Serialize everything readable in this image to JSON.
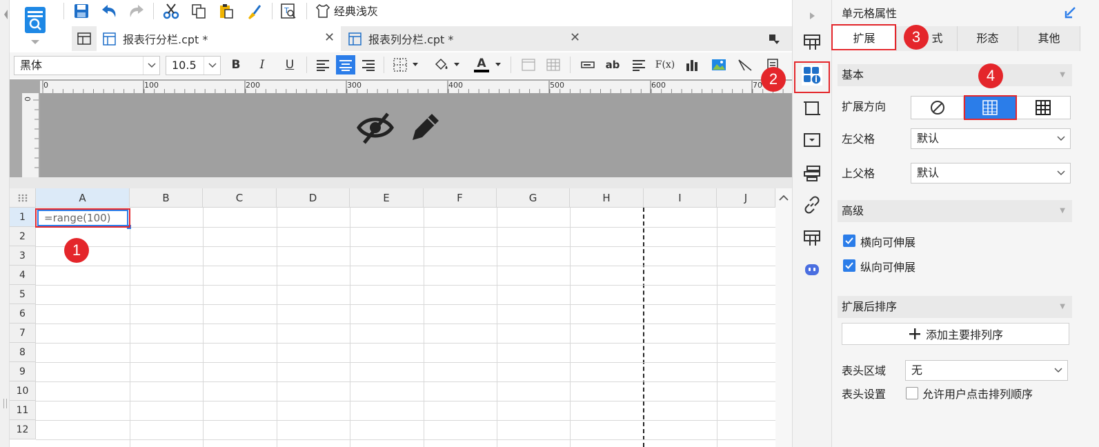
{
  "toolbar": {
    "theme_label": "经典浅灰"
  },
  "tabs": [
    {
      "label": "报表行分栏.cpt *",
      "active": true
    },
    {
      "label": "报表列分栏.cpt *",
      "active": false
    }
  ],
  "format_bar": {
    "font_family": "黑体",
    "font_size": "10.5",
    "bold": "B",
    "italic": "I",
    "underline": "U",
    "text_ab": "ab",
    "fx": "F(x)",
    "text_color_glyph": "A"
  },
  "ruler": {
    "marks": [
      "0",
      "100",
      "200",
      "300",
      "400",
      "500",
      "600",
      "70"
    ],
    "left_mark": "0"
  },
  "grid": {
    "columns": [
      "A",
      "B",
      "C",
      "D",
      "E",
      "F",
      "G",
      "H",
      "I",
      "J"
    ],
    "rows": [
      "1",
      "2",
      "3",
      "4",
      "5",
      "6",
      "7",
      "8",
      "9",
      "10",
      "11",
      "12"
    ],
    "cell_a1": "=range(100)"
  },
  "panel": {
    "title": "单元格属性",
    "tabs": [
      "扩展",
      "样式",
      "形态",
      "其他"
    ],
    "tab_visible": [
      "扩展",
      "式",
      "形态",
      "其他"
    ],
    "basic": {
      "header": "基本",
      "direction_label": "扩展方向",
      "left_parent_label": "左父格",
      "left_parent_value": "默认",
      "top_parent_label": "上父格",
      "top_parent_value": "默认"
    },
    "advanced": {
      "header": "高级",
      "horizontal_label": "横向可伸展",
      "vertical_label": "纵向可伸展"
    },
    "sort": {
      "header": "扩展后排序",
      "add_button": "添加主要排列序"
    },
    "header_area": {
      "label": "表头区域",
      "value": "无",
      "settings_label": "表头设置",
      "settings_checkbox": "允许用户点击排列顺序"
    }
  },
  "annotations": [
    "1",
    "2",
    "3",
    "4"
  ],
  "colors": {
    "accent_blue": "#2b7de9",
    "annotation_red": "#e4262b"
  }
}
